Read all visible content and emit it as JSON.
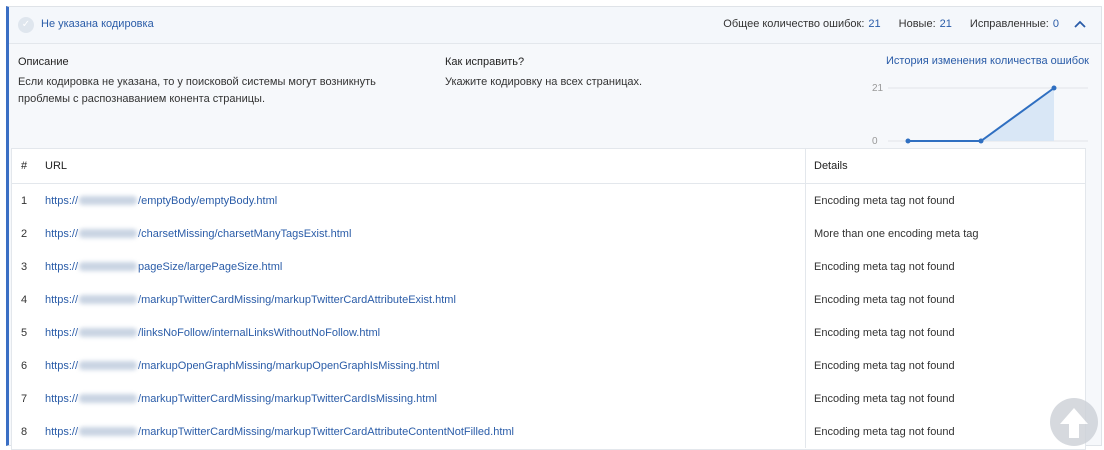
{
  "header": {
    "title": "Не указана кодировка",
    "total_label": "Общее количество ошибок:",
    "total_value": "21",
    "new_label": "Новые:",
    "new_value": "21",
    "fixed_label": "Исправленные:",
    "fixed_value": "0"
  },
  "description": {
    "heading": "Описание",
    "text_line1": "Если кодировка не указана, то у поисковой системы могут возникнуть",
    "text_line2": "проблемы с распознаванием конента страницы."
  },
  "fix": {
    "heading": "Как исправить?",
    "text": "Укажите кодировку на всех страницах."
  },
  "history": {
    "link": "История изменения количества ошибок"
  },
  "chart_data": {
    "type": "area",
    "title": "",
    "y_ticks": [
      "21",
      "0"
    ],
    "ylim": [
      0,
      21
    ],
    "values": [
      0,
      0,
      21
    ],
    "color": "#2f6fc1"
  },
  "table": {
    "headers": {
      "num": "#",
      "url": "URL",
      "details": "Details"
    },
    "rows": [
      {
        "num": "1",
        "url_prefix": "https://",
        "url_path": "/emptyBody/emptyBody.html",
        "details": "Encoding meta tag not found"
      },
      {
        "num": "2",
        "url_prefix": "https://",
        "url_path": "/charsetMissing/charsetManyTagsExist.html",
        "details": "More than one encoding meta tag"
      },
      {
        "num": "3",
        "url_prefix": "https://",
        "url_path": "pageSize/largePageSize.html",
        "details": "Encoding meta tag not found"
      },
      {
        "num": "4",
        "url_prefix": "https://",
        "url_path": "/markupTwitterCardMissing/markupTwitterCardAttributeExist.html",
        "details": "Encoding meta tag not found"
      },
      {
        "num": "5",
        "url_prefix": "https://",
        "url_path": "/linksNoFollow/internalLinksWithoutNoFollow.html",
        "details": "Encoding meta tag not found"
      },
      {
        "num": "6",
        "url_prefix": "https://",
        "url_path": "/markupOpenGraphMissing/markupOpenGraphIsMissing.html",
        "details": "Encoding meta tag not found"
      },
      {
        "num": "7",
        "url_prefix": "https://",
        "url_path": "/markupTwitterCardMissing/markupTwitterCardIsMissing.html",
        "details": "Encoding meta tag not found"
      },
      {
        "num": "8",
        "url_prefix": "https://",
        "url_path": "/markupTwitterCardMissing/markupTwitterCardAttributeContentNotFilled.html",
        "details": "Encoding meta tag not found"
      }
    ]
  }
}
